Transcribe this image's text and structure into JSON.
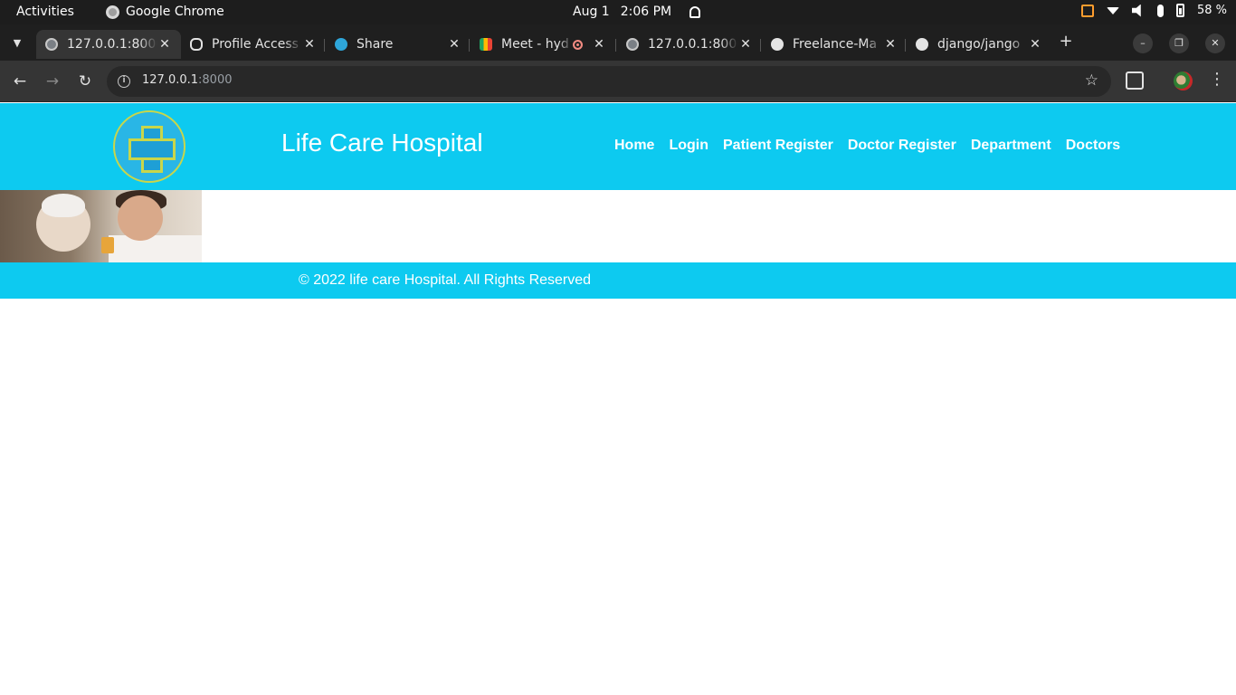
{
  "system_bar": {
    "activities": "Activities",
    "app_name": "Google Chrome",
    "date": "Aug 1",
    "time": "2:06 PM",
    "battery": "58 %"
  },
  "browser": {
    "tabs": [
      {
        "title": "127.0.0.1:8000",
        "icon": "globe-icon",
        "active": true
      },
      {
        "title": "Profile Access",
        "icon": "openai-icon",
        "active": false
      },
      {
        "title": "Share",
        "icon": "telegram-icon",
        "active": false
      },
      {
        "title": "Meet - hyd",
        "icon": "meet-icon",
        "active": false,
        "recording": true
      },
      {
        "title": "127.0.0.1:8000",
        "icon": "globe-icon",
        "active": false
      },
      {
        "title": "Freelance-Ma",
        "icon": "github-icon",
        "active": false
      },
      {
        "title": "django/jango",
        "icon": "github-icon",
        "active": false
      }
    ],
    "url_host": "127.0.0.1",
    "url_port": ":8000"
  },
  "site": {
    "title": "Life Care Hospital",
    "nav": [
      "Home",
      "Login",
      "Patient Register",
      "Doctor Register",
      "Department",
      "Doctors"
    ],
    "footer": "© 2022 life care Hospital. All Rights Reserved"
  },
  "colors": {
    "brand": "#0dcaf0",
    "chrome_dark": "#1f1f1f",
    "chrome_toolbar": "#353535"
  }
}
